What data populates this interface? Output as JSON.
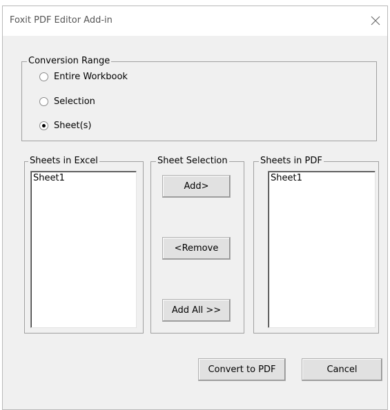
{
  "window": {
    "title": "Foxit PDF Editor Add-in"
  },
  "conversion_range": {
    "legend": "Conversion Range",
    "options": [
      {
        "label": "Entire Workbook",
        "checked": false
      },
      {
        "label": "Selection",
        "checked": false
      },
      {
        "label": "Sheet(s)",
        "checked": true
      }
    ]
  },
  "sheets_in_excel": {
    "legend": "Sheets in Excel",
    "items": [
      "Sheet1"
    ]
  },
  "sheet_selection": {
    "legend": "Sheet Selection",
    "add_label": "Add>",
    "remove_label": "<Remove",
    "add_all_label": "Add All >>"
  },
  "sheets_in_pdf": {
    "legend": "Sheets in PDF",
    "items": [
      "Sheet1"
    ]
  },
  "footer": {
    "convert_label": "Convert to PDF",
    "cancel_label": "Cancel"
  }
}
